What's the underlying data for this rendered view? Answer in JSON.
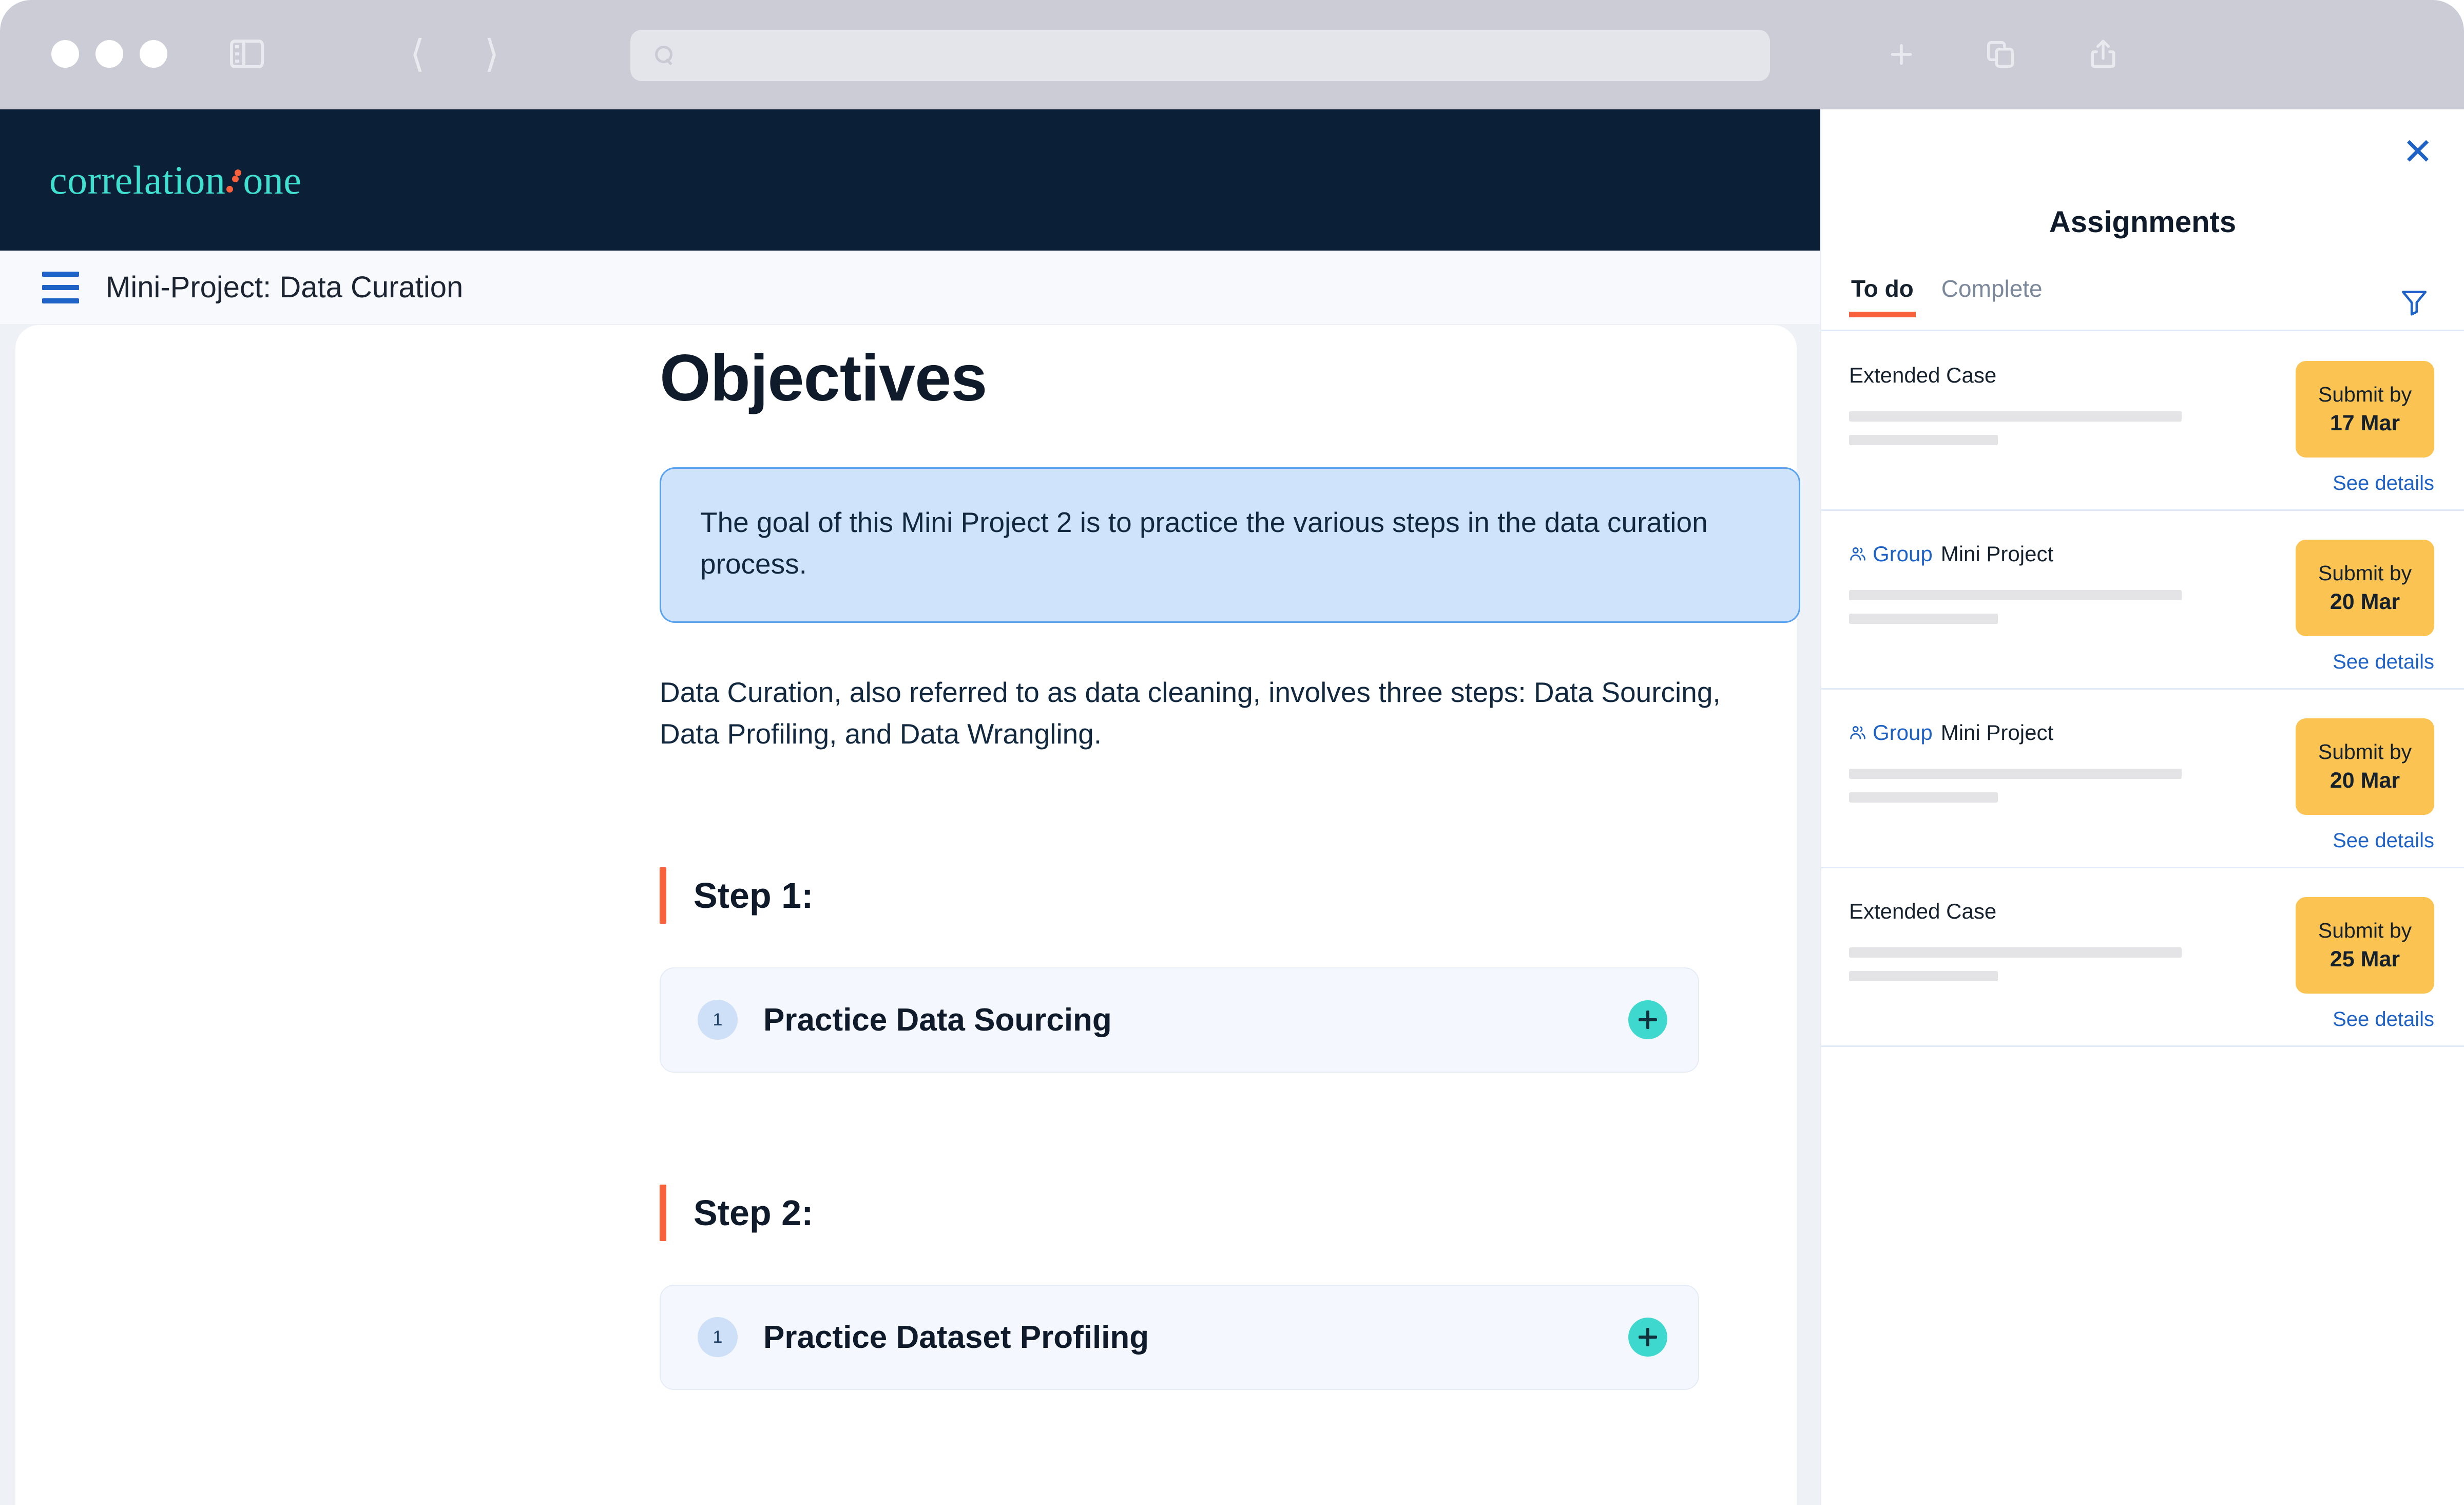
{
  "browser": {
    "traffic_lights": [
      "close",
      "minimize",
      "maximize"
    ],
    "sidebar_toggle_icon": "sidebar-icon",
    "back_icon": "chevron-left-icon",
    "forward_icon": "chevron-right-icon",
    "address_value": "",
    "address_placeholder": "",
    "search_icon": "search-icon",
    "new_tab_icon": "plus-icon",
    "tabs_overview_icon": "tabs-icon",
    "share_icon": "share-icon"
  },
  "app": {
    "brand": {
      "text_before": "correlation",
      "text_after": "one",
      "teal": "#3fe0cf",
      "dot_color": "#f9603c",
      "bar_background": "#0b1f37"
    },
    "header": {
      "menu_icon": "hamburger-icon",
      "title": "Mini-Project: Data Curation"
    }
  },
  "document": {
    "heading": "Objectives",
    "callout": {
      "text": "The goal of this Mini Project 2 is to practice the various steps in the data curation process.",
      "background": "#cfe4fb",
      "border": "#5aa2ee"
    },
    "paragraph": "Data Curation, also referred to as data cleaning, involves three steps: Data Sourcing, Data Profiling, and Data Wrangling.",
    "steps": [
      {
        "label": "Step 1:",
        "accent": "#f9603c",
        "task": {
          "number": "1",
          "title": "Practice Data Sourcing",
          "action_icon": "plus-icon"
        }
      },
      {
        "label": "Step 2:",
        "accent": "#f9603c",
        "task": {
          "number": "1",
          "title": "Practice Dataset Profiling",
          "action_icon": "plus-icon"
        }
      }
    ]
  },
  "assignments_panel": {
    "close_icon": "close-icon",
    "title": "Assignments",
    "filter_icon": "filter-icon",
    "tabs": [
      {
        "label": "To do",
        "active": true
      },
      {
        "label": "Complete",
        "active": false
      }
    ],
    "active_tab_underline_color": "#f9603c",
    "due_chip_color": "#fbc351",
    "link_color": "#1d62c4",
    "items": [
      {
        "group_label": "",
        "title": "Extended Case",
        "due_label": "Submit by",
        "due_date": "17 Mar",
        "details_link": "See details"
      },
      {
        "group_label": "Group",
        "group_icon": "people-icon",
        "title": "Mini Project",
        "due_label": "Submit by",
        "due_date": "20 Mar",
        "details_link": "See details"
      },
      {
        "group_label": "Group",
        "group_icon": "people-icon",
        "title": "Mini Project",
        "due_label": "Submit by",
        "due_date": "20 Mar",
        "details_link": "See details"
      },
      {
        "group_label": "",
        "title": "Extended Case",
        "due_label": "Submit by",
        "due_date": "25 Mar",
        "details_link": "See details"
      }
    ]
  }
}
